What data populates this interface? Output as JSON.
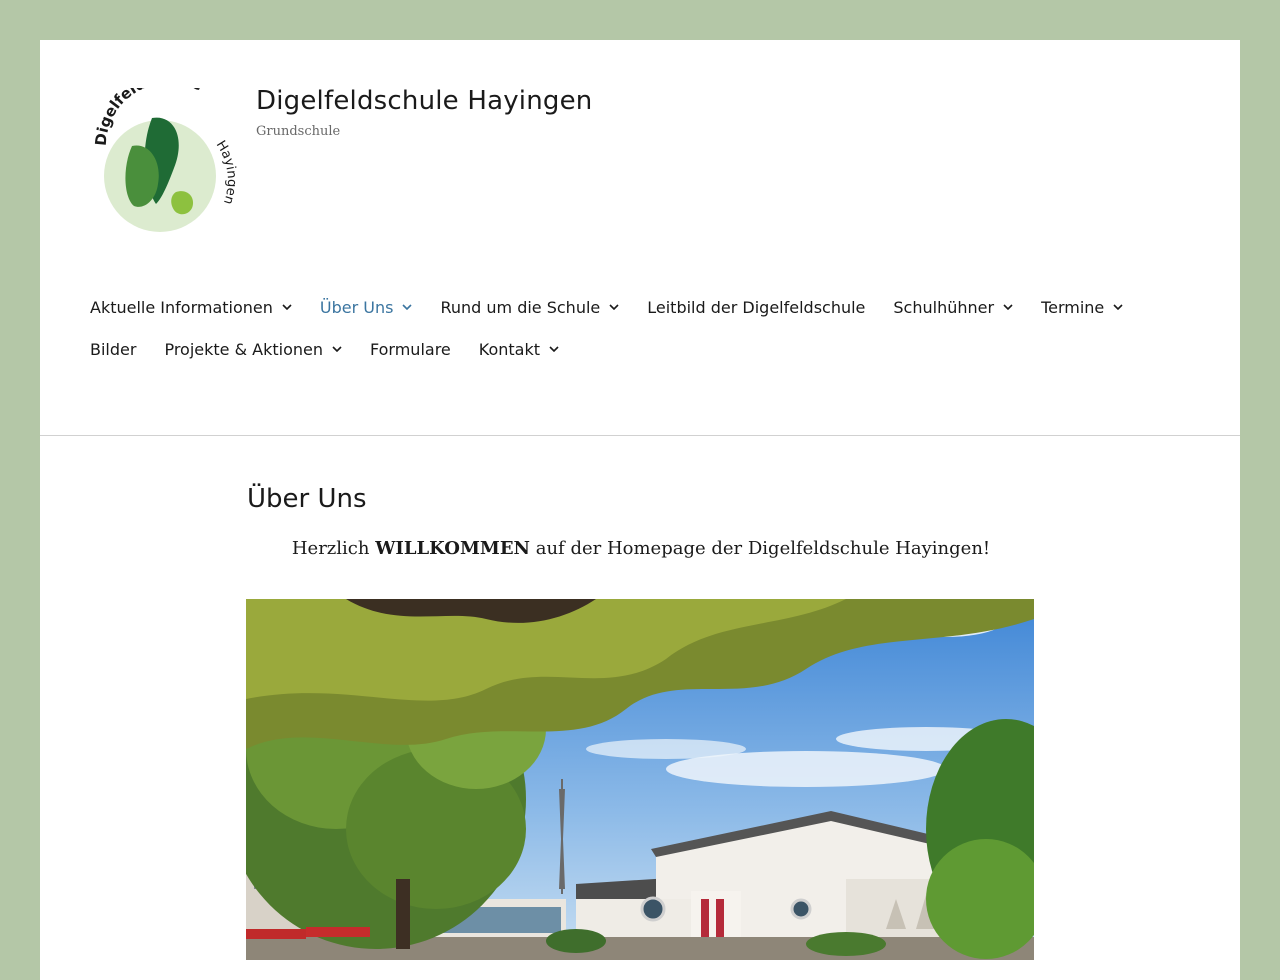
{
  "header": {
    "site_title": "Digelfeldschule Hayingen",
    "site_description": "Grundschule",
    "logo_text_main": "Digelfeldschule",
    "logo_text_side": "Hayingen"
  },
  "nav": {
    "row1": [
      {
        "label": "Aktuelle Informationen",
        "has_submenu": true
      },
      {
        "label": "Über Uns",
        "has_submenu": true,
        "active": true
      },
      {
        "label": "Rund um die Schule",
        "has_submenu": true
      },
      {
        "label": "Leitbild der Digelfeldschule",
        "has_submenu": false
      },
      {
        "label": "Schulhühner",
        "has_submenu": true
      },
      {
        "label": "Termine",
        "has_submenu": true
      }
    ],
    "row2": [
      {
        "label": "Bilder",
        "has_submenu": false
      },
      {
        "label": "Projekte & Aktionen",
        "has_submenu": true
      },
      {
        "label": "Formulare",
        "has_submenu": false
      },
      {
        "label": "Kontakt",
        "has_submenu": true
      }
    ]
  },
  "content": {
    "title": "Über Uns",
    "welcome_pre": "Herzlich ",
    "welcome_strong": "WILLKOMMEN",
    "welcome_post": " auf der Homepage der Digelfeldschule Hayingen!"
  },
  "colors": {
    "background": "#b4c7a7",
    "active_link": "#3b75a0",
    "leaf_dark": "#1f6b35",
    "leaf_mid": "#4a8f3c",
    "leaf_light": "#8dc13f"
  }
}
